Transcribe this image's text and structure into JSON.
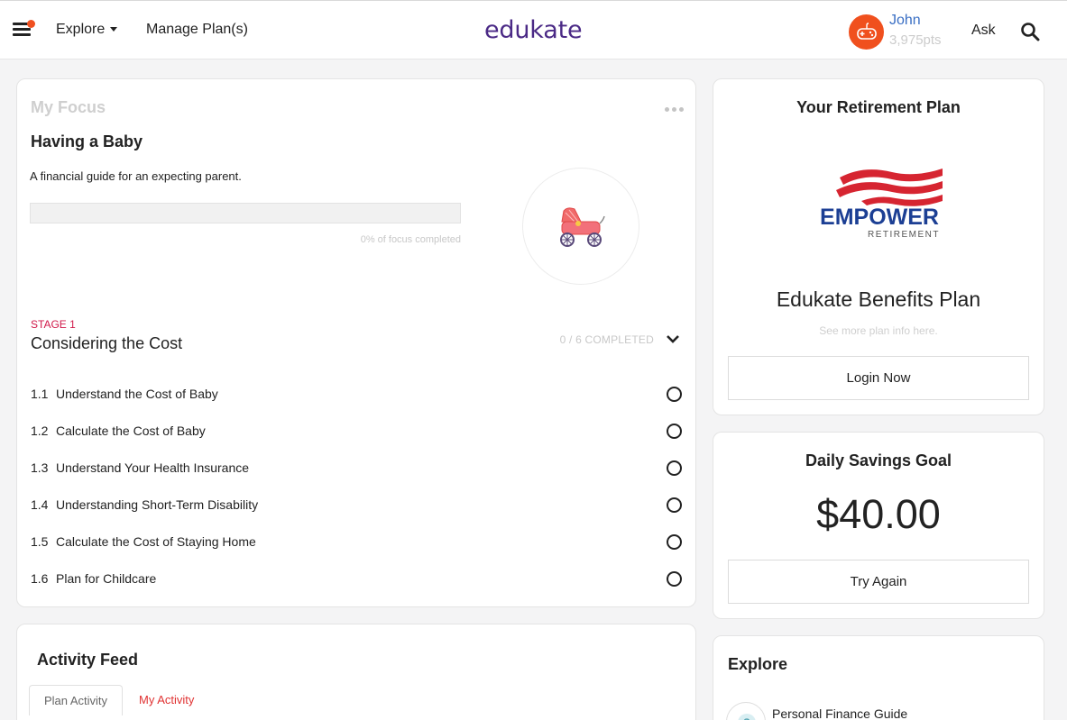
{
  "header": {
    "explore_label": "Explore",
    "manage_label": "Manage Plan(s)",
    "logo_text": "edukate",
    "user_name": "John",
    "user_points": "3,975pts",
    "ask_label": "Ask",
    "accent_color": "#4b2a86",
    "notification_color": "#f05020"
  },
  "focus": {
    "section_label": "My Focus",
    "title": "Having a Baby",
    "description": "A financial guide for an expecting parent.",
    "progress_percent": 0,
    "progress_text": "0% of focus completed",
    "icon": "stroller-icon",
    "stage": {
      "label": "STAGE 1",
      "title": "Considering the Cost",
      "completed_text": "0 / 6 COMPLETED",
      "tasks": [
        {
          "num": "1.1",
          "label": "Understand the Cost of Baby"
        },
        {
          "num": "1.2",
          "label": "Calculate the Cost of Baby"
        },
        {
          "num": "1.3",
          "label": "Understand Your Health Insurance"
        },
        {
          "num": "1.4",
          "label": "Understanding Short-Term Disability"
        },
        {
          "num": "1.5",
          "label": "Calculate the Cost of Staying Home"
        },
        {
          "num": "1.6",
          "label": "Plan for Childcare"
        }
      ]
    }
  },
  "activity": {
    "title": "Activity Feed",
    "tabs": [
      "Plan Activity",
      "My Activity"
    ]
  },
  "retirement": {
    "title": "Your Retirement Plan",
    "logo_main": "EMPOWER",
    "logo_sub": "RETIREMENT",
    "logo_color": "#1c3f94",
    "plan_name": "Edukate Benefits Plan",
    "plan_link": "See more plan info here.",
    "login_label": "Login Now"
  },
  "savings": {
    "title": "Daily Savings Goal",
    "amount": "$40.00",
    "button_label": "Try Again"
  },
  "explore": {
    "title": "Explore",
    "guide_label": "Personal Finance Guide"
  }
}
